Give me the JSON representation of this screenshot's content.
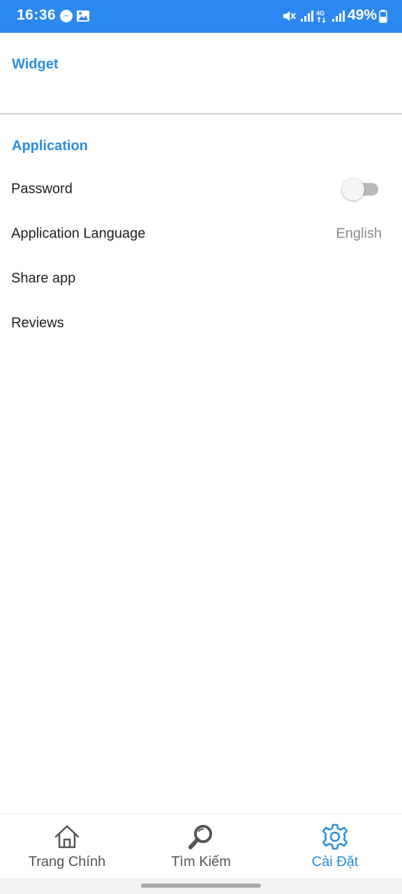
{
  "status_bar": {
    "time": "16:36",
    "battery": "49%",
    "icons": [
      "messenger-icon",
      "gallery-icon",
      "mute-icon",
      "signal-icon",
      "4g-icon",
      "signal-icon",
      "battery-icon"
    ]
  },
  "sections": {
    "widget_title": "Widget",
    "application_title": "Application"
  },
  "settings": {
    "password_label": "Password",
    "password_enabled": false,
    "language_label": "Application Language",
    "language_value": "English",
    "share_label": "Share app",
    "reviews_label": "Reviews"
  },
  "bottom_nav": {
    "home_label": "Trang Chính",
    "search_label": "Tìm Kiếm",
    "settings_label": "Cài Đặt",
    "active": "settings"
  },
  "colors": {
    "status_bar": "#2b88f0",
    "accent": "#2b8fdc"
  }
}
